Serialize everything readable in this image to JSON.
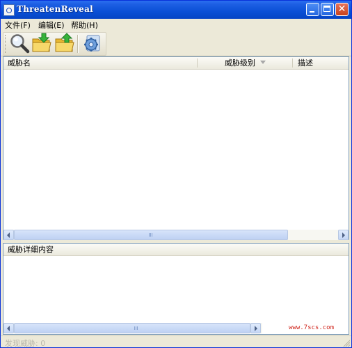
{
  "window": {
    "title": "ThreatenReveal"
  },
  "menu": {
    "file": "文件(F)",
    "edit": "编辑(E)",
    "help": "帮助(H)"
  },
  "toolbar": {
    "buttons": [
      {
        "icon": "magnifier-icon"
      },
      {
        "icon": "folder-import-icon"
      },
      {
        "icon": "folder-export-icon"
      },
      {
        "icon": "settings-gear-icon"
      }
    ]
  },
  "threat_list": {
    "columns": [
      "威胁名",
      "威胁级别",
      "描述"
    ],
    "rows": []
  },
  "detail_panel": {
    "title": "威胁详细内容",
    "watermark": "www.7scs.com"
  },
  "status": {
    "text": "发现威胁: 0"
  },
  "colors": {
    "titlebar": "#0a4fd6",
    "close_button": "#c8421d",
    "watermark": "#d0261d"
  }
}
